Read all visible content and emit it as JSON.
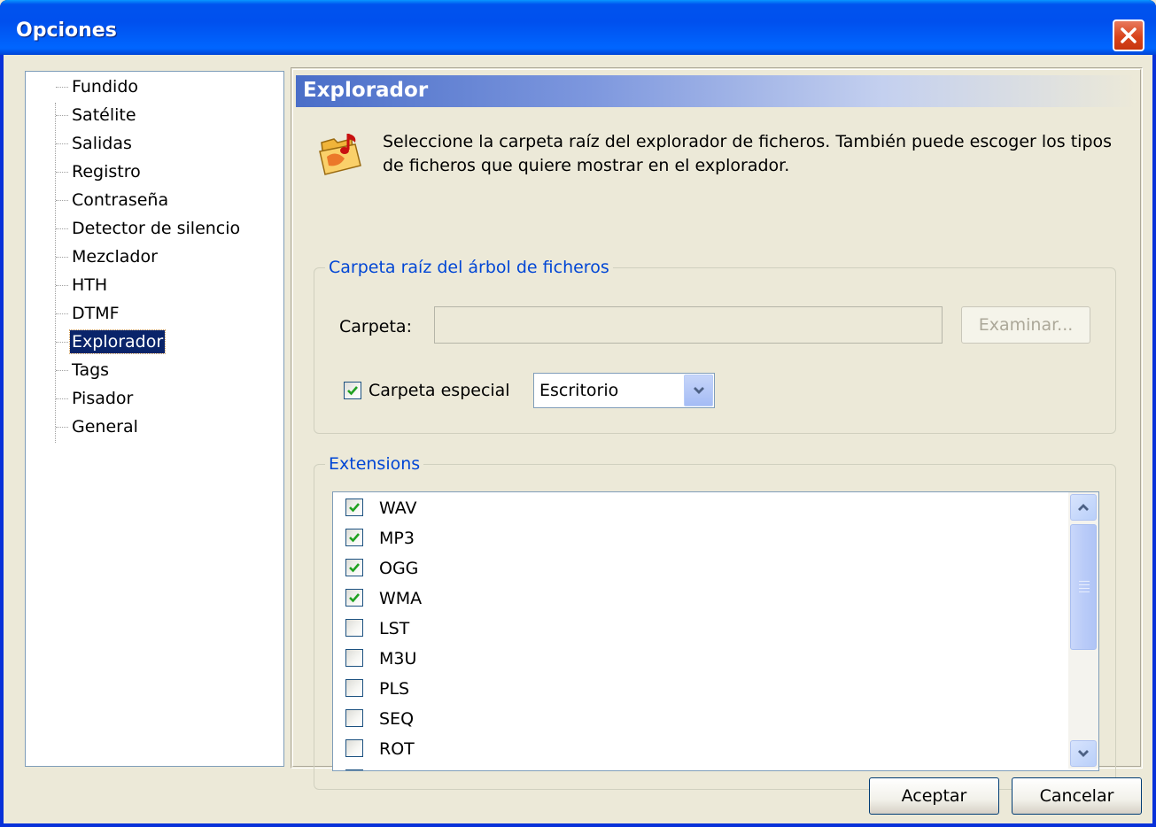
{
  "window": {
    "title": "Opciones"
  },
  "tree": {
    "items": [
      {
        "label": "Fundido"
      },
      {
        "label": "Satélite"
      },
      {
        "label": "Salidas"
      },
      {
        "label": "Registro"
      },
      {
        "label": "Contraseña"
      },
      {
        "label": "Detector de silencio"
      },
      {
        "label": "Mezclador"
      },
      {
        "label": "HTH"
      },
      {
        "label": "DTMF"
      },
      {
        "label": "Explorador",
        "selected": true
      },
      {
        "label": "Tags"
      },
      {
        "label": "Pisador"
      },
      {
        "label": "General"
      }
    ]
  },
  "panel": {
    "title": "Explorador",
    "description": "Seleccione la carpeta raíz del explorador de ficheros. También puede escoger los tipos de ficheros que quiere mostrar en el explorador.",
    "root_group": {
      "legend": "Carpeta raíz del árbol de ficheros",
      "folder_label": "Carpeta:",
      "folder_value": "",
      "browse_label": "Examinar...",
      "special_label": "Carpeta especial",
      "special_checked": true,
      "special_value": "Escritorio"
    },
    "ext_group": {
      "legend": "Extensions",
      "items": [
        {
          "label": "WAV",
          "checked": true
        },
        {
          "label": "MP3",
          "checked": true
        },
        {
          "label": "OGG",
          "checked": true
        },
        {
          "label": "WMA",
          "checked": true
        },
        {
          "label": "LST",
          "checked": false
        },
        {
          "label": "M3U",
          "checked": false
        },
        {
          "label": "PLS",
          "checked": false
        },
        {
          "label": "SEQ",
          "checked": false
        },
        {
          "label": "ROT",
          "checked": false
        }
      ]
    }
  },
  "footer": {
    "ok_label": "Aceptar",
    "cancel_label": "Cancelar"
  },
  "colors": {
    "titlebar": "#0054E3",
    "selection": "#0A246A",
    "group_legend": "#0046D5",
    "check": "#21A121"
  }
}
